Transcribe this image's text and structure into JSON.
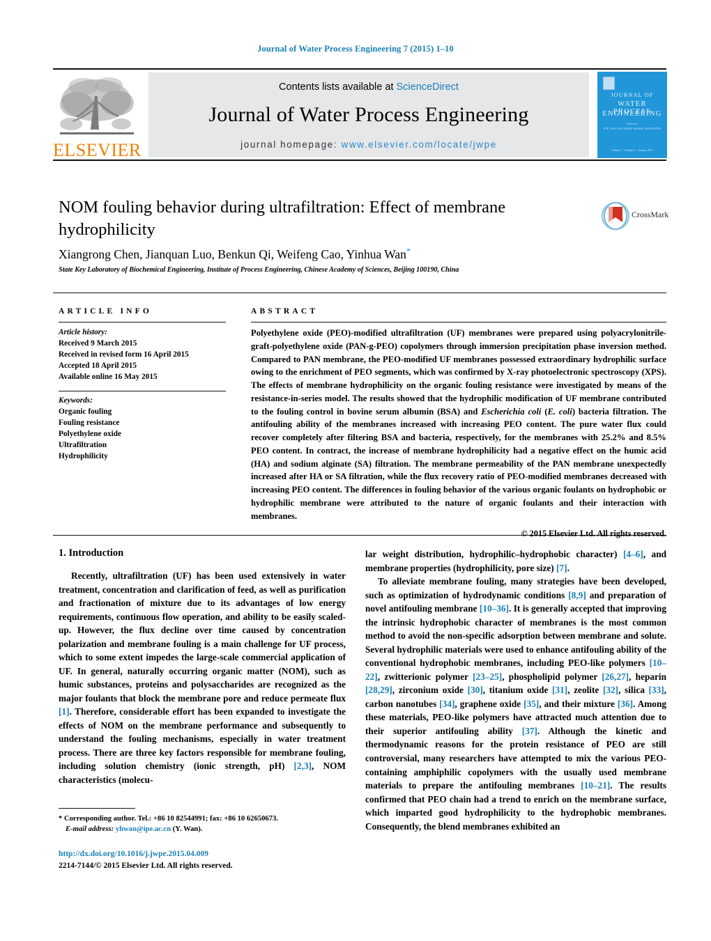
{
  "running_head": "Journal of Water Process Engineering 7 (2015) 1–10",
  "masthead": {
    "contents_prefix": "Contents lists available at ",
    "sciencedirect": "ScienceDirect",
    "journal_title": "Journal of Water Process Engineering",
    "homepage_prefix": "journal homepage: ",
    "homepage_url": "www.elsevier.com/locate/jwpe",
    "elsevier_wordmark": "ELSEVIER",
    "cover": {
      "line1": "JOURNAL OF",
      "line2": "WATER PROCESS",
      "line3": "ENGINEERING",
      "sub1": "Editors",
      "sub2": "P.B. PALANISAMI    MARK WIESNER",
      "footer": "Volume 7 · Number 1 · January 2015"
    },
    "accent_color": "#1a7fb5",
    "band_color": "#e6e7e8",
    "cover_color": "#2196d8",
    "elsevier_orange": "#f08000"
  },
  "article": {
    "title": "NOM fouling behavior during ultrafiltration: Effect of membrane hydrophilicity",
    "authors": "Xiangrong Chen, Jianquan Luo, Benkun Qi, Weifeng Cao, Yinhua Wan",
    "corresponding_marker": "*",
    "affiliation": "State Key Laboratory of Biochemical Engineering, Institute of Process Engineering, Chinese Academy of Sciences, Beijing 100190, China",
    "crossmark_label": "CrossMark"
  },
  "article_info": {
    "heading": "ARTICLE INFO",
    "history_label": "Article history:",
    "history": [
      "Received 9 March 2015",
      "Received in revised form 16 April 2015",
      "Accepted 18 April 2015",
      "Available online 16 May 2015"
    ],
    "keywords_label": "Keywords:",
    "keywords": [
      "Organic fouling",
      "Fouling resistance",
      "Polyethylene oxide",
      "Ultrafiltration",
      "Hydrophilicity"
    ]
  },
  "abstract": {
    "heading": "ABSTRACT",
    "part1": "Polyethylene oxide (PEO)-modified ultrafiltration (UF) membranes were prepared using polyacrylonitrile-graft-polyethylene oxide (PAN-g-PEO) copolymers through immersion precipitation phase inversion method. Compared to PAN membrane, the PEO-modified UF membranes possessed extraordinary hydrophilic surface owing to the enrichment of PEO segments, which was confirmed by X-ray photoelectronic spectroscopy (XPS). The effects of membrane hydrophilicity on the organic fouling resistance were investigated by means of the resistance-in-series model. The results showed that the hydrophilic modification of UF membrane contributed to the fouling control in bovine serum albumin (BSA) and ",
    "italic1": "Escherichia coli",
    "part2": " (",
    "italic2": "E. coli",
    "part3": ") bacteria filtration. The antifouling ability of the membranes increased with increasing PEO content. The pure water flux could recover completely after filtering BSA and bacteria, respectively, for the membranes with 25.2% and 8.5% PEO content. In contract, the increase of membrane hydrophilicity had a negative effect on the humic acid (HA) and sodium alginate (SA) filtration. The membrane permeability of the PAN membrane unexpectedly increased after HA or SA filtration, while the flux recovery ratio of PEO-modified membranes decreased with increasing PEO content. The differences in fouling behavior of the various organic foulants on hydrophobic or hydrophilic membrane were attributed to the nature of organic foulants and their interaction with membranes.",
    "copyright": "© 2015 Elsevier Ltd. All rights reserved."
  },
  "introduction": {
    "section_title": "1. Introduction",
    "left_p1": "Recently, ultrafiltration (UF) has been used extensively in water treatment, concentration and clarification of feed, as well as purification and fractionation of mixture due to its advantages of low energy requirements, continuous flow operation, and ability to be easily scaled-up. However, the flux decline over time caused by concentration polarization and membrane fouling is a main challenge for UF process, which to some extent impedes the large-scale commercial application of UF. In general, naturally occurring organic matter (NOM), such as humic substances, proteins and polysaccharides are recognized as the major foulants that block the membrane pore and reduce permeate flux ",
    "ref1": "[1]",
    "left_p1b": ". Therefore, considerable effort has been expanded to investigate the effects of NOM on the membrane performance and subsequently to understand the fouling mechanisms, especially in water treatment process. There are three key factors responsible for membrane fouling, including solution chemistry (ionic strength, pH) ",
    "ref2": "[2,3]",
    "left_p1c": ", NOM characteristics (molecu-",
    "right_p1a": "lar weight distribution, hydrophilic–hydrophobic character) ",
    "ref3": "[4–6]",
    "right_p1b": ", and membrane properties (hydrophilicity, pore size) ",
    "ref4": "[7]",
    "right_p1c": ".",
    "right_p2a": "To alleviate membrane fouling, many strategies have been developed, such as optimization of hydrodynamic conditions ",
    "ref5": "[8,9]",
    "right_p2b": " and preparation of novel antifouling membrane ",
    "ref6": "[10–36]",
    "right_p2c": ". It is generally accepted that improving the intrinsic hydrophobic character of membranes is the most common method to avoid the non-specific adsorption between membrane and solute. Several hydrophilic materials were used to enhance antifouling ability of the conventional hydrophobic membranes, including PEO-like polymers ",
    "ref7": "[10–22]",
    "right_p2d": ", zwitterionic polymer ",
    "ref8": "[23–25]",
    "right_p2e": ", phospholipid polymer ",
    "ref9": "[26,27]",
    "right_p2f": ", heparin ",
    "ref10": "[28,29]",
    "right_p2g": ", zirconium oxide ",
    "ref11": "[30]",
    "right_p2h": ", titanium oxide ",
    "ref12": "[31]",
    "right_p2i": ", zeolite ",
    "ref13": "[32]",
    "right_p2j": ", silica ",
    "ref14": "[33]",
    "right_p2k": ", carbon nanotubes ",
    "ref15": "[34]",
    "right_p2l": ", graphene oxide ",
    "ref16": "[35]",
    "right_p2m": ", and their mixture ",
    "ref17": "[36]",
    "right_p2n": ". Among these materials, PEO-like polymers have attracted much attention due to their superior antifouling ability ",
    "ref18": "[37]",
    "right_p2o": ". Although the kinetic and thermodynamic reasons for the protein resistance of PEO are still controversial, many researchers have attempted to mix the various PEO-containing amphiphilic copolymers with the usually used membrane materials to prepare the antifouling membranes ",
    "ref19": "[10–21]",
    "right_p2p": ". The results confirmed that PEO chain had a trend to enrich on the membrane surface, which imparted good hydrophilicity to the hydrophobic membranes. Consequently, the blend membranes exhibited an"
  },
  "footer": {
    "footnote_marker": "*",
    "footnote_text": " Corresponding author. Tel.: +86 10 82544991; fax: +86 10 62650673.",
    "email_label": "E-mail address:",
    "email": "yhwan@ipe.ac.cn",
    "email_suffix": " (Y. Wan).",
    "doi": "http://dx.doi.org/10.1016/j.jwpe.2015.04.009",
    "issn_line": "2214-7144/© 2015 Elsevier Ltd. All rights reserved."
  }
}
